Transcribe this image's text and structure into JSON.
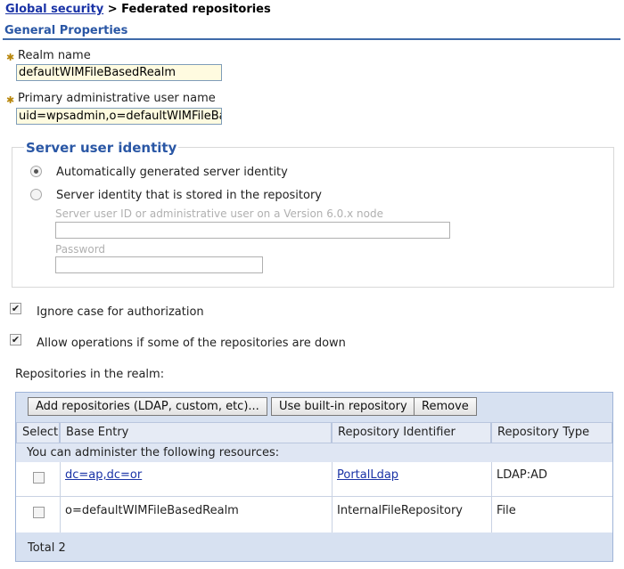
{
  "breadcrumb": {
    "parent": "Global security",
    "separator": ">",
    "current": "Federated repositories"
  },
  "section": {
    "title": "General Properties"
  },
  "realm": {
    "label": "Realm name",
    "value": "defaultWIMFileBasedRealm"
  },
  "primary_admin": {
    "label": "Primary administrative user name",
    "value": "uid=wpsadmin,o=defaultWIMFileBas"
  },
  "server_identity": {
    "legend": "Server user identity",
    "option_auto": "Automatically generated server identity",
    "option_repo": "Server identity that is stored in the repository",
    "user_id_label": "Server user ID or administrative user on a Version 6.0.x node",
    "password_label": "Password"
  },
  "options": {
    "ignore_case": "Ignore case for authorization",
    "allow_ops": "Allow operations if some of the repositories are down"
  },
  "repositories": {
    "heading": "Repositories in the realm:",
    "buttons": {
      "add": "Add repositories (LDAP, custom, etc)...",
      "builtin": "Use built-in repository",
      "remove": "Remove"
    },
    "columns": {
      "select": "Select",
      "base_entry": "Base Entry",
      "identifier": "Repository Identifier",
      "type": "Repository Type"
    },
    "notice": "You can administer the following resources:",
    "rows": [
      {
        "base_entry": "dc=ap,dc=or",
        "identifier": "PortalLdap",
        "type": "LDAP:AD"
      },
      {
        "base_entry": "o=defaultWIMFileBasedRealm",
        "identifier": "InternalFileRepository",
        "type": "File"
      }
    ],
    "total": "Total 2"
  },
  "colors": {
    "accent": "#2a57a5",
    "link": "#1a33a6",
    "required": "#b8860b",
    "table_bg": "#d7e1f1"
  }
}
